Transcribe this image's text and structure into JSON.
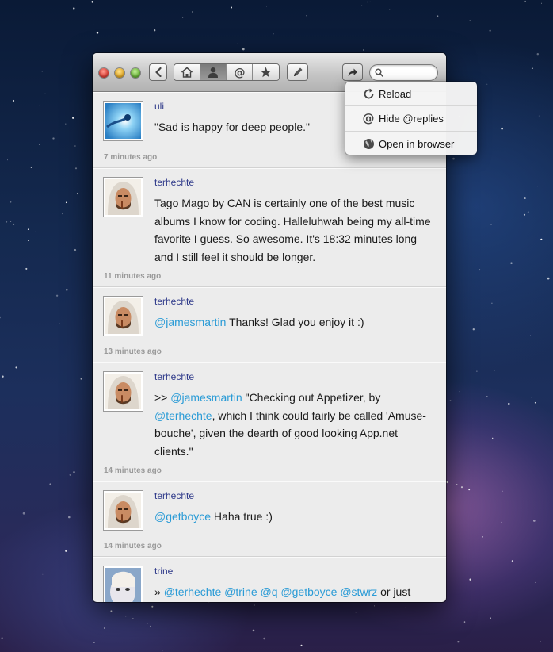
{
  "toolbar": {
    "icons": [
      "back-icon",
      "home-icon",
      "user-icon",
      "mention-icon",
      "star-icon",
      "compose-icon",
      "share-icon",
      "search-icon"
    ],
    "search_placeholder": ""
  },
  "menu": {
    "items": [
      {
        "icon": "reload-icon",
        "label": "Reload"
      },
      {
        "icon": "at-icon",
        "label": "Hide @replies"
      },
      {
        "icon": "globe-icon",
        "label": "Open in browser"
      }
    ]
  },
  "posts": [
    {
      "user": "uli",
      "segments": [
        {
          "t": "\"Sad is happy for deep people.\""
        }
      ],
      "time": "7 minutes ago",
      "avatar": "abstract"
    },
    {
      "user": "terhechte",
      "segments": [
        {
          "t": "Tago Mago by CAN is certainly one of the best music albums I know for coding. Halleluhwah being my all-time favorite I guess. So awesome. It's 18:32 minutes long and I still feel it should be longer."
        }
      ],
      "time": "11 minutes ago",
      "avatar": "hood"
    },
    {
      "user": "terhechte",
      "segments": [
        {
          "t": "@jamesmartin",
          "m": true
        },
        {
          "t": " Thanks! Glad you enjoy it :)"
        }
      ],
      "time": "13 minutes ago",
      "avatar": "hood"
    },
    {
      "user": "terhechte",
      "segments": [
        {
          "t": ">> "
        },
        {
          "t": "@jamesmartin",
          "m": true
        },
        {
          "t": " \"Checking out Appetizer, by "
        },
        {
          "t": "@terhechte",
          "m": true
        },
        {
          "t": ", which I think could fairly be called 'Amuse-bouche', given the dearth of  good looking App.net clients.\""
        }
      ],
      "time": "14 minutes ago",
      "avatar": "hood"
    },
    {
      "user": "terhechte",
      "segments": [
        {
          "t": "@getboyce",
          "m": true
        },
        {
          "t": " Haha true :)"
        }
      ],
      "time": "14 minutes ago",
      "avatar": "hood"
    },
    {
      "user": "trine",
      "segments": [
        {
          "t": "» "
        },
        {
          "t": "@terhechte",
          "m": true
        },
        {
          "t": " "
        },
        {
          "t": "@trine",
          "m": true
        },
        {
          "t": " "
        },
        {
          "t": "@q",
          "m": true
        },
        {
          "t": " "
        },
        {
          "t": "@getboyce",
          "m": true
        },
        {
          "t": " "
        },
        {
          "t": "@stwrz",
          "m": true
        },
        {
          "t": " or just"
        }
      ],
      "time": "",
      "avatar": "face"
    }
  ]
}
